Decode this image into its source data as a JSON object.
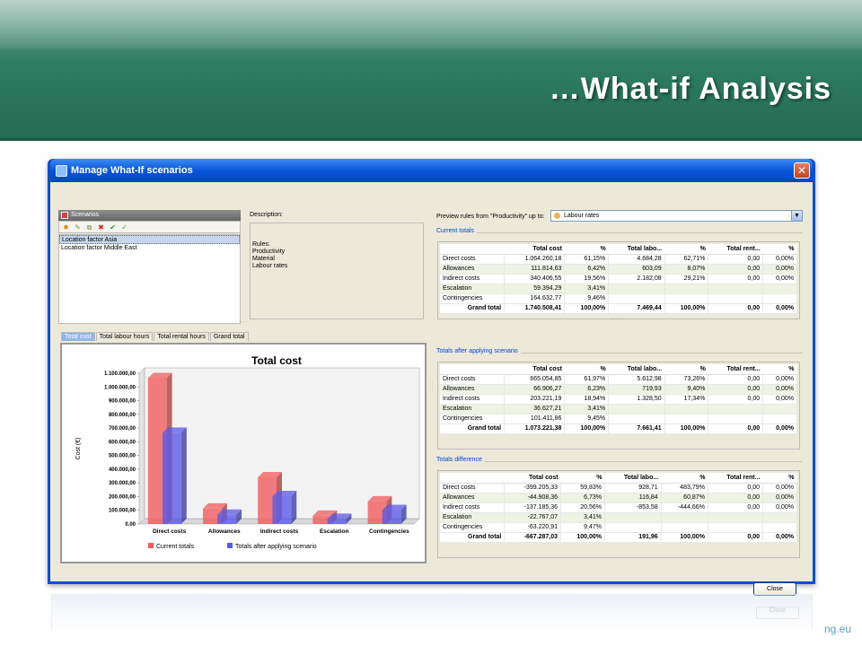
{
  "slide": {
    "title": "…What-if Analysis",
    "footer_url": "ng.eu",
    "reflection_button": "Close"
  },
  "window": {
    "title": "Manage What-If scenarios",
    "close_label": "Close"
  },
  "scenarios": {
    "header": "Scenarios",
    "toolbar_icons": [
      "add-icon",
      "edit-icon",
      "copy-icon",
      "delete-icon",
      "apply-check-icon",
      "approve-icon"
    ],
    "items": [
      "Location factor Asia",
      "Location factor Middle East"
    ]
  },
  "description": {
    "label": "Description:",
    "rules_title": "Rules:",
    "rules": [
      "Productivity",
      "Material",
      "Labour rates"
    ]
  },
  "chart_tabs": [
    "Total cost",
    "Total labour hours",
    "Total rental hours",
    "Grand total"
  ],
  "preview": {
    "label": "Preview rules from \"Productivity\" up to:",
    "selected": "Labour rates"
  },
  "tables": {
    "current": {
      "title": "Current totals",
      "headers": [
        "",
        "Total cost",
        "%",
        "Total labo...",
        "%",
        "Total rent...",
        "%"
      ],
      "rows": [
        [
          "Direct costs",
          "1.064.260,18",
          "61,15%",
          "4.684,28",
          "62,71%",
          "0,00",
          "0,00%"
        ],
        [
          "Allowances",
          "111.814,63",
          "6,42%",
          "603,09",
          "8,07%",
          "0,00",
          "0,00%"
        ],
        [
          "Indirect costs",
          "340.406,55",
          "19,56%",
          "2.182,08",
          "29,21%",
          "0,00",
          "0,00%"
        ],
        [
          "Escalation",
          "59.394,29",
          "3,41%",
          "",
          "",
          "",
          ""
        ],
        [
          "Contingencies",
          "164.632,77",
          "9,46%",
          "",
          "",
          "",
          ""
        ],
        [
          "Grand total",
          "1.740.508,41",
          "100,00%",
          "7.469,44",
          "100,00%",
          "0,00",
          "0,00%"
        ]
      ]
    },
    "after": {
      "title": "Totals after applying scenario",
      "headers": [
        "",
        "Total cost",
        "%",
        "Total labo...",
        "%",
        "Total rent...",
        "%"
      ],
      "rows": [
        [
          "Direct costs",
          "665.054,85",
          "61,97%",
          "5.612,98",
          "73,26%",
          "0,00",
          "0,00%"
        ],
        [
          "Allowances",
          "66.906,27",
          "6,23%",
          "719,93",
          "9,40%",
          "0,00",
          "0,00%"
        ],
        [
          "Indirect costs",
          "203.221,19",
          "18,94%",
          "1.328,50",
          "17,34%",
          "0,00",
          "0,00%"
        ],
        [
          "Escalation",
          "36.627,21",
          "3,41%",
          "",
          "",
          "",
          ""
        ],
        [
          "Contingencies",
          "101.411,86",
          "9,45%",
          "",
          "",
          "",
          ""
        ],
        [
          "Grand total",
          "1.073.221,38",
          "100,00%",
          "7.661,41",
          "100,00%",
          "0,00",
          "0,00%"
        ]
      ]
    },
    "difference": {
      "title": "Totals difference",
      "headers": [
        "",
        "Total cost",
        "%",
        "Total labo...",
        "%",
        "Total rent...",
        "%"
      ],
      "rows": [
        [
          "Direct costs",
          "-399.205,33",
          "59,83%",
          "928,71",
          "483,79%",
          "0,00",
          "0,00%"
        ],
        [
          "Allowances",
          "-44.908,36",
          "6,73%",
          "116,84",
          "60,87%",
          "0,00",
          "0,00%"
        ],
        [
          "Indirect costs",
          "-137.185,36",
          "20,56%",
          "-853,58",
          "-444,66%",
          "0,00",
          "0,00%"
        ],
        [
          "Escalation",
          "-22.767,07",
          "3,41%",
          "",
          "",
          "",
          ""
        ],
        [
          "Contingencies",
          "-63.220,91",
          "9,47%",
          "",
          "",
          "",
          ""
        ],
        [
          "Grand total",
          "-667.287,03",
          "100,00%",
          "191,96",
          "100,00%",
          "0,00",
          "0,00%"
        ]
      ]
    }
  },
  "chart_data": {
    "type": "bar",
    "title": "Total cost",
    "ylabel": "Cost (€)",
    "xlabel": "",
    "categories": [
      "Direct costs",
      "Allowances",
      "Indirect costs",
      "Escalation",
      "Contingencies"
    ],
    "series": [
      {
        "name": "Current totals",
        "color": "#f25b5b",
        "values": [
          1064260.18,
          111814.63,
          340406.55,
          59394.29,
          164632.77
        ]
      },
      {
        "name": "Totals after applying scenario",
        "color": "#5a5ae8",
        "values": [
          665054.85,
          66906.27,
          203221.19,
          36627.21,
          101411.86
        ]
      }
    ],
    "yticks": [
      "0.00",
      "100.000,00",
      "200.000,00",
      "300.000,00",
      "400.000,00",
      "500.000,00",
      "600.000,00",
      "700.000,00",
      "800.000,00",
      "900.000,00",
      "1.000.000,00",
      "1.100.000,00"
    ],
    "ylim": [
      0,
      1100000
    ],
    "legend_position": "bottom",
    "grid": false
  }
}
